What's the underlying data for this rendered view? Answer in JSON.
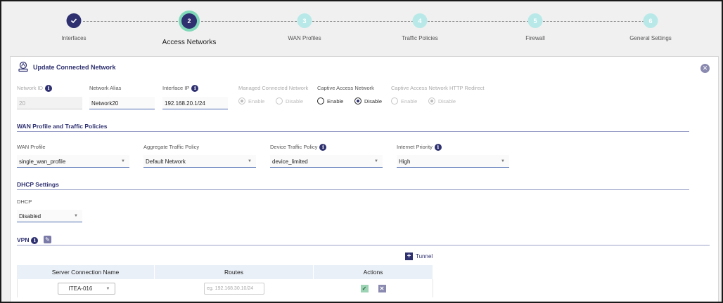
{
  "stepper": {
    "steps": [
      {
        "number": "✓",
        "label": "Interfaces",
        "state": "done"
      },
      {
        "number": "2",
        "label": "Access Networks",
        "state": "active"
      },
      {
        "number": "3",
        "label": "WAN Profiles",
        "state": "pending"
      },
      {
        "number": "4",
        "label": "Traffic Policies",
        "state": "pending"
      },
      {
        "number": "5",
        "label": "Firewall",
        "state": "pending"
      },
      {
        "number": "6",
        "label": "General Settings",
        "state": "pending"
      }
    ]
  },
  "card": {
    "title": "Update Connected Network",
    "close_icon": "close-circle-icon"
  },
  "network": {
    "network_id": {
      "label": "Network ID",
      "value": "20"
    },
    "network_alias": {
      "label": "Network Alias",
      "value": "Network20"
    },
    "interface_ip": {
      "label": "Interface IP",
      "value": "192.168.20.1/24"
    },
    "managed": {
      "label": "Managed Connected Network",
      "enable": "Enable",
      "disable": "Disable",
      "selected": "Enable"
    },
    "captive": {
      "label": "Captive Access Network",
      "enable": "Enable",
      "disable": "Disable",
      "selected": "Disable"
    },
    "captive_redirect": {
      "label": "Captive Access Network HTTP Redirect",
      "enable": "Enable",
      "disable": "Disable",
      "selected": "Disable"
    }
  },
  "wan_section": {
    "title": "WAN Profile and Traffic Policies",
    "wan_profile": {
      "label": "WAN Profile",
      "value": "single_wan_profile"
    },
    "aggregate_policy": {
      "label": "Aggregate Traffic Policy",
      "value": "Default Network"
    },
    "device_policy": {
      "label": "Device Traffic Policy",
      "value": "device_limited"
    },
    "internet_priority": {
      "label": "Internet Priority",
      "value": "High"
    }
  },
  "dhcp_section": {
    "title": "DHCP Settings",
    "dhcp": {
      "label": "DHCP",
      "value": "Disabled"
    }
  },
  "vpn_section": {
    "title": "VPN",
    "tunnel_button": "Tunnel",
    "table": {
      "headers": [
        "Server Connection Name",
        "Routes",
        "Actions"
      ],
      "rows": [
        {
          "server": "ITEA-016",
          "routes_placeholder": "eg. 192.168.30.10/24"
        }
      ]
    }
  },
  "colors": {
    "primary": "#2e3070",
    "accent_ring": "#7fd9b8",
    "pending_step": "#b8e9e8"
  }
}
